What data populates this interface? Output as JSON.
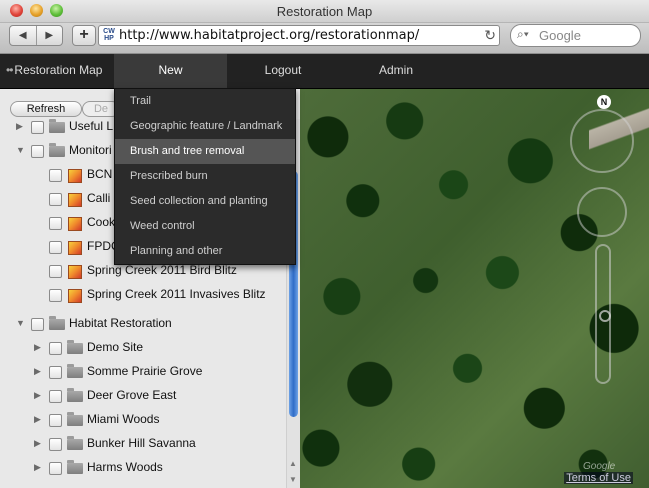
{
  "browser": {
    "window_title": "Restoration Map",
    "url": "http://www.habitatproject.org/restorationmap/",
    "search_placeholder": "Google",
    "favicon_text": "CW HP"
  },
  "app_nav": {
    "brand": "Restoration Map",
    "items": [
      "New",
      "Logout",
      "Admin"
    ]
  },
  "new_menu": {
    "items": [
      "Trail",
      "Geographic feature / Landmark",
      "Brush and tree removal",
      "Prescribed burn",
      "Seed collection and planting",
      "Weed control",
      "Planning and other"
    ],
    "highlighted": "Brush and tree removal"
  },
  "panel": {
    "refresh_label": "Refresh",
    "second_button_label": "De",
    "tree": [
      {
        "label": "Useful L",
        "kind": "folder",
        "expanded": false,
        "level": 0
      },
      {
        "label": "Monitori",
        "kind": "folder",
        "expanded": true,
        "level": 0
      },
      {
        "label": "BCN",
        "kind": "monitor",
        "level": 1
      },
      {
        "label": "Calli",
        "kind": "monitor",
        "level": 1
      },
      {
        "label": "Cook",
        "kind": "monitor",
        "level": 1
      },
      {
        "label": "FPDC",
        "kind": "monitor",
        "level": 1
      },
      {
        "label": "Spring Creek 2011 Bird Blitz",
        "kind": "monitor",
        "level": 1
      },
      {
        "label": "Spring Creek 2011 Invasives Blitz",
        "kind": "monitor",
        "level": 1
      },
      {
        "label": "Habitat Restoration",
        "kind": "folder",
        "expanded": true,
        "level": 0
      },
      {
        "label": "Demo Site",
        "kind": "folder",
        "expanded": false,
        "level": 1
      },
      {
        "label": "Somme Prairie Grove",
        "kind": "folder",
        "expanded": false,
        "level": 1
      },
      {
        "label": "Deer Grove East",
        "kind": "folder",
        "expanded": false,
        "level": 1
      },
      {
        "label": "Miami Woods",
        "kind": "folder",
        "expanded": false,
        "level": 1
      },
      {
        "label": "Bunker Hill Savanna",
        "kind": "folder",
        "expanded": false,
        "level": 1
      },
      {
        "label": "Harms Woods",
        "kind": "folder",
        "expanded": false,
        "level": 1
      }
    ]
  },
  "map": {
    "compass_label": "N",
    "attribution": "Google",
    "terms_link": "Terms of Use"
  },
  "colors": {
    "nav_bg": "#222222",
    "menu_bg": "#2b2b2b",
    "menu_highlight": "#555555",
    "scroll_thumb": "#2f6cc7"
  }
}
